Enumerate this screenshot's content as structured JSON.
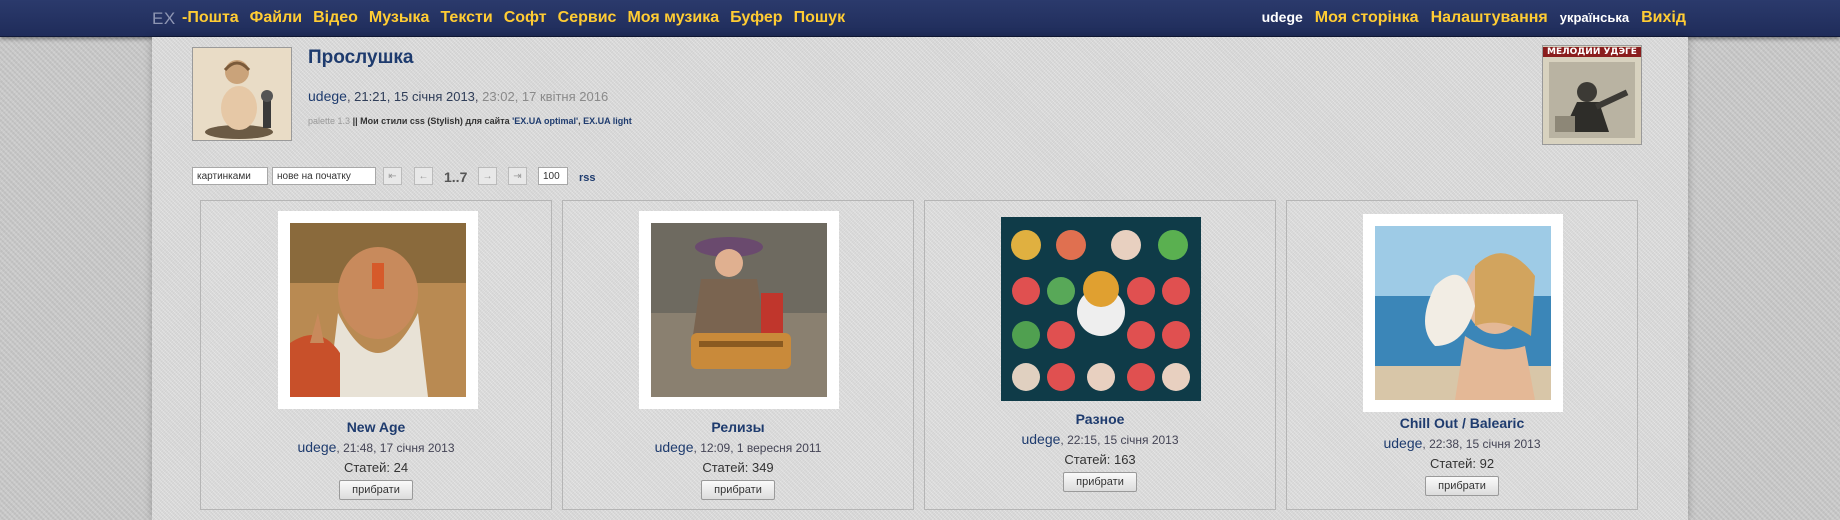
{
  "topnav": {
    "logo_text": "EX",
    "left_links": [
      "-Пошта",
      "Файли",
      "Відео",
      "Музыка",
      "Тексти",
      "Софт",
      "Сервис",
      "Моя музика",
      "Буфер",
      "Пошук"
    ],
    "username": "udege",
    "my_page": "Моя сторінка",
    "settings": "Налаштування",
    "language": "українська",
    "logout": "Вихід"
  },
  "header": {
    "title": "Прослушка",
    "author": "udege",
    "created": "21:21, 15 січня 2013",
    "updated": "23:02, 17 квітня 2016",
    "palette_label": "palette 1.3",
    "separator": "||",
    "desc_text": "Мои стили css (Stylish) для сайта",
    "desc_link1": "'EX.UA optimal'",
    "desc_comma": ",",
    "desc_link2": "EX.UA light",
    "cover_caption": "МЕЛОДИИ УДЭГЕ"
  },
  "toolbar": {
    "view_mode": "картинками",
    "sort_mode": "нове на початку",
    "first_icon": "first-page-icon",
    "prev_icon": "prev-page-icon",
    "pages": "1..7",
    "next_icon": "next-page-icon",
    "last_icon": "last-page-icon",
    "per_page": "100",
    "rss": "rss"
  },
  "cards": [
    {
      "title": "New Age",
      "author": "udege",
      "date": "21:48, 17 січня 2013",
      "count": "Статей: 24",
      "button": "прибрати"
    },
    {
      "title": "Релизы",
      "author": "udege",
      "date": "12:09, 1 вересня 2011",
      "count": "Статей: 349",
      "button": "прибрати"
    },
    {
      "title": "Разное",
      "author": "udege",
      "date": "22:15, 15 січня 2013",
      "count": "Статей: 163",
      "button": "прибрати"
    },
    {
      "title": "Chill Out / Balearic",
      "author": "udege",
      "date": "22:38, 15 січня 2013",
      "count": "Статей: 92",
      "button": "прибрати"
    }
  ],
  "colors": {
    "nav_bg": "#24325f",
    "nav_link": "#ffcc33",
    "title": "#1e3b6e"
  }
}
